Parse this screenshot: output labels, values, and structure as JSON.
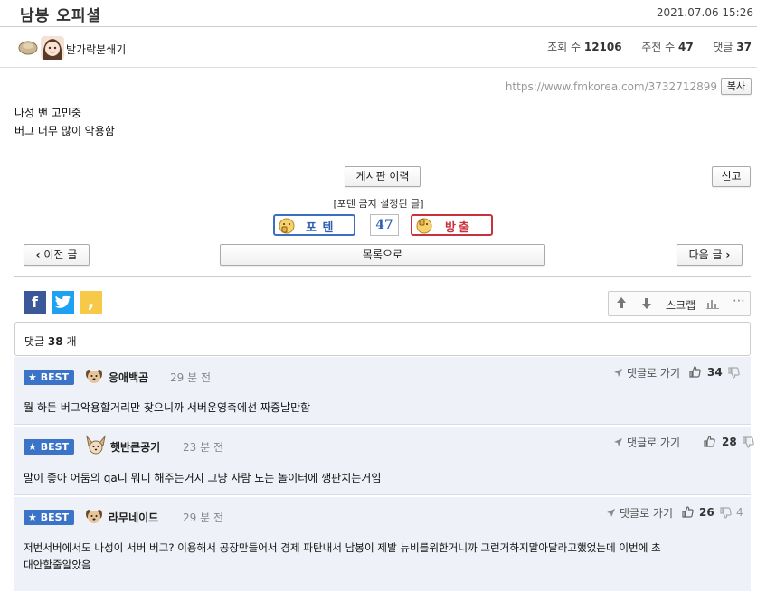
{
  "post": {
    "title": "남봉 오피셜",
    "datetime": "2021.07.06 15:26",
    "author": "발가락분쇄기",
    "views_label": "조회 수",
    "views": "12106",
    "recommend_label": "추천 수",
    "recommend": "47",
    "comments_label": "댓글",
    "comments": "37",
    "url": "https://www.fmkorea.com/3732712899",
    "copy_label": "복사",
    "body_lines": [
      "나성 밴 고민중",
      "버그 너무 많이 악용함"
    ]
  },
  "actions": {
    "history_label": "게시판 이력",
    "report_label": "신고",
    "potten_notice": "[포텐 금지 설정된 글]",
    "potten_label": "포 텐",
    "vote_count": "47",
    "bangchul_label": "방출",
    "prev_label": "이전 글",
    "list_label": "목록으로",
    "next_label": "다음 글"
  },
  "share": {
    "facebook": "f",
    "twitter": "t",
    "kakao": ",",
    "scrap_label": "스크랩"
  },
  "comments_header": {
    "prefix": "댓글",
    "count": "38",
    "suffix": "개"
  },
  "comments": [
    {
      "badge": "BEST",
      "nick": "응애백곰",
      "time": "29 분 전",
      "text": "뭘 하든 버그악용할거리만 찾으니까 서버운영측에선 짜증날만함",
      "reply_label": "댓글로 가기",
      "up": "34",
      "down": ""
    },
    {
      "badge": "BEST",
      "nick": "햇반큰공기",
      "time": "23 분 전",
      "text": "말이 좋아 어둠의 qa니 뭐니 해주는거지 그냥 사람 노는 놀이터에 깽판치는거임",
      "reply_label": "댓글로 가기",
      "up": "28",
      "down": ""
    },
    {
      "badge": "BEST",
      "nick": "라무네이드",
      "time": "29 분 전",
      "text_lines": [
        "저번서버에서도 나성이 서버 버그? 이용해서 공장만들어서 경제 파탄내서 남봉이 제발 뉴비를위한거니까 그런거하지말아달라고했었는데 이번에 초",
        "대안할줄알았음"
      ],
      "reply_label": "댓글로 가기",
      "up": "26",
      "down": "4"
    }
  ],
  "colors": {
    "best_badge": "#3b73c8",
    "comment_bg": "#eef1f8",
    "potten_border": "#3a6fc4",
    "bangchul_border": "#c8323c",
    "facebook": "#3b5998",
    "twitter": "#1da1f2",
    "kakao": "#f7c948"
  }
}
